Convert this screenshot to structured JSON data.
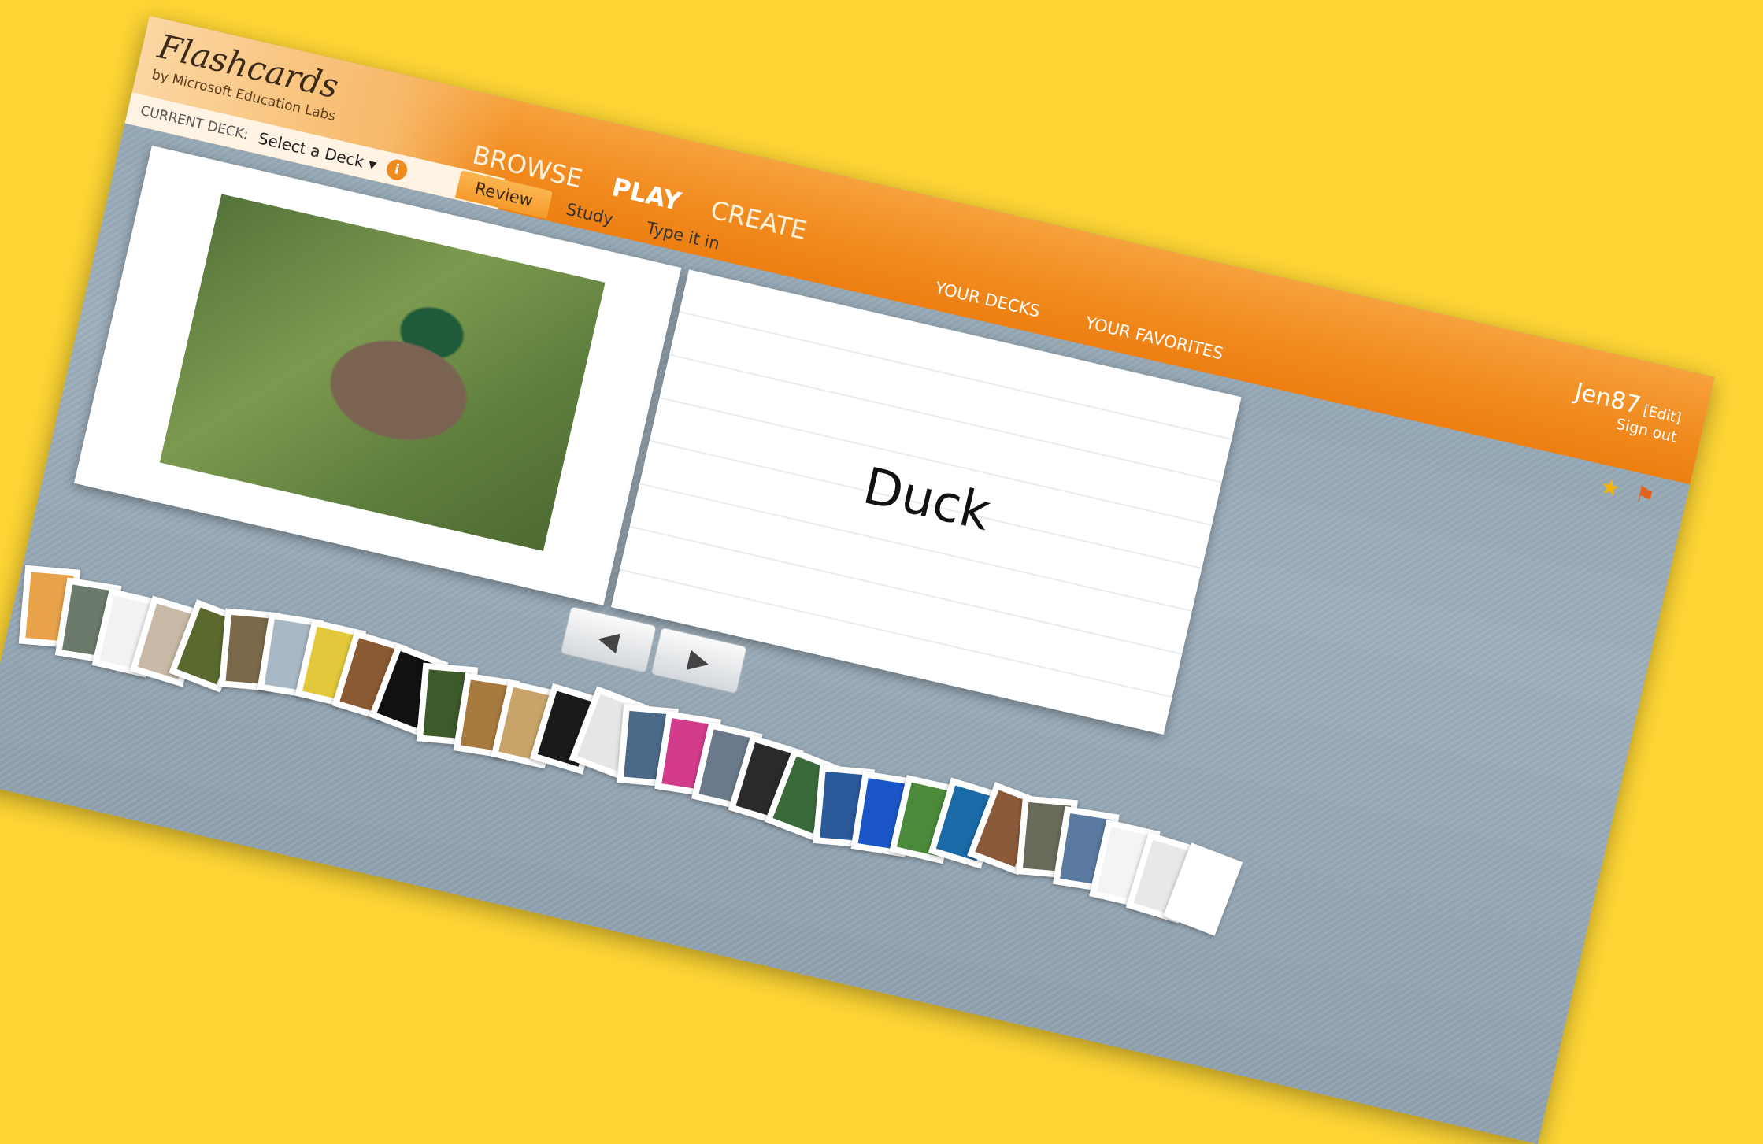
{
  "app": {
    "logo": "Flashcards",
    "logo_sub": "by Microsoft Education Labs"
  },
  "deck": {
    "label": "CURRENT DECK:",
    "select_value": "Select a Deck ▾",
    "info": "i"
  },
  "nav": {
    "browse": "BROWSE",
    "play": "PLAY",
    "create": "CREATE"
  },
  "subnav": {
    "review": "Review",
    "study": "Study",
    "type_it_in": "Type it in"
  },
  "usernav": {
    "your_decks": "YOUR DECKS",
    "your_favorites": "YOUR FAVORITES"
  },
  "user": {
    "name": "Jen87",
    "edit": "[Edit]",
    "sign_out": "Sign out"
  },
  "tools": {
    "star": "★",
    "flag": "⚑"
  },
  "card": {
    "word": "Duck"
  },
  "controls": {
    "prev": "◀",
    "next": "▶"
  },
  "thumbnails": [
    {
      "color": "#e8a24a"
    },
    {
      "color": "#6b7a6a"
    },
    {
      "color": "#f2f2f2"
    },
    {
      "color": "#c7b9a5"
    },
    {
      "color": "#5a6a2e"
    },
    {
      "color": "#7a6a4a"
    },
    {
      "color": "#a8b8c4"
    },
    {
      "color": "#e2c83a"
    },
    {
      "color": "#8a5a32"
    },
    {
      "color": "#111111"
    },
    {
      "color": "#3d5a2a"
    },
    {
      "color": "#a77a3e"
    },
    {
      "color": "#c9a46a"
    },
    {
      "color": "#1a1a1a"
    },
    {
      "color": "#e6e6e6"
    },
    {
      "color": "#4b6a8a"
    },
    {
      "color": "#d23c8a"
    },
    {
      "color": "#6a7a8a"
    },
    {
      "color": "#2a2a2a"
    },
    {
      "color": "#3a6a3a"
    },
    {
      "color": "#2a5a9a"
    },
    {
      "color": "#1a56c8"
    },
    {
      "color": "#4a8a3a"
    },
    {
      "color": "#1a6aa8"
    },
    {
      "color": "#8a5a3a"
    },
    {
      "color": "#6a6a5a"
    },
    {
      "color": "#5a7aa0"
    },
    {
      "color": "#f4f4f4"
    },
    {
      "color": "#e8e8e8"
    },
    {
      "color": "#ffffff"
    }
  ]
}
